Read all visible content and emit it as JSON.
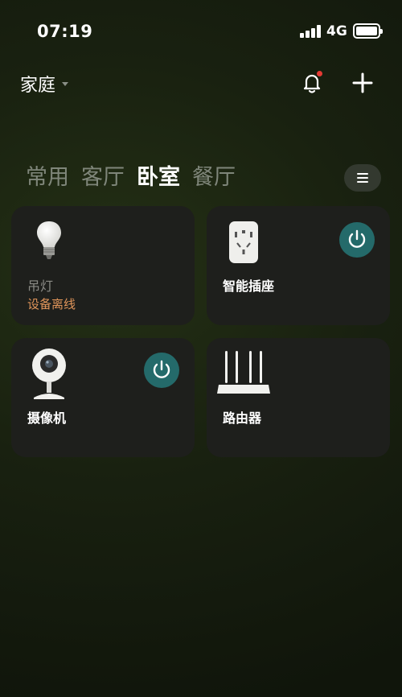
{
  "status_bar": {
    "time": "07:19",
    "network": "4G"
  },
  "header": {
    "home_label": "家庭"
  },
  "tabs": [
    {
      "label": "常用",
      "active": false
    },
    {
      "label": "客厅",
      "active": false
    },
    {
      "label": "卧室",
      "active": true
    },
    {
      "label": "餐厅",
      "active": false
    }
  ],
  "devices": [
    {
      "name": "吊灯",
      "status": "设备离线",
      "icon": "bulb-icon",
      "power_button": false
    },
    {
      "name": "智能插座",
      "status": "",
      "icon": "smart-plug-icon",
      "power_button": true
    },
    {
      "name": "摄像机",
      "status": "",
      "icon": "camera-icon",
      "power_button": true
    },
    {
      "name": "路由器",
      "status": "",
      "icon": "router-icon",
      "power_button": false
    }
  ],
  "colors": {
    "background": "#141a0e",
    "card": "#1e1f1c",
    "power_button": "#246a6a",
    "offline_text": "#e0955a",
    "notification_dot": "#e53a34"
  }
}
